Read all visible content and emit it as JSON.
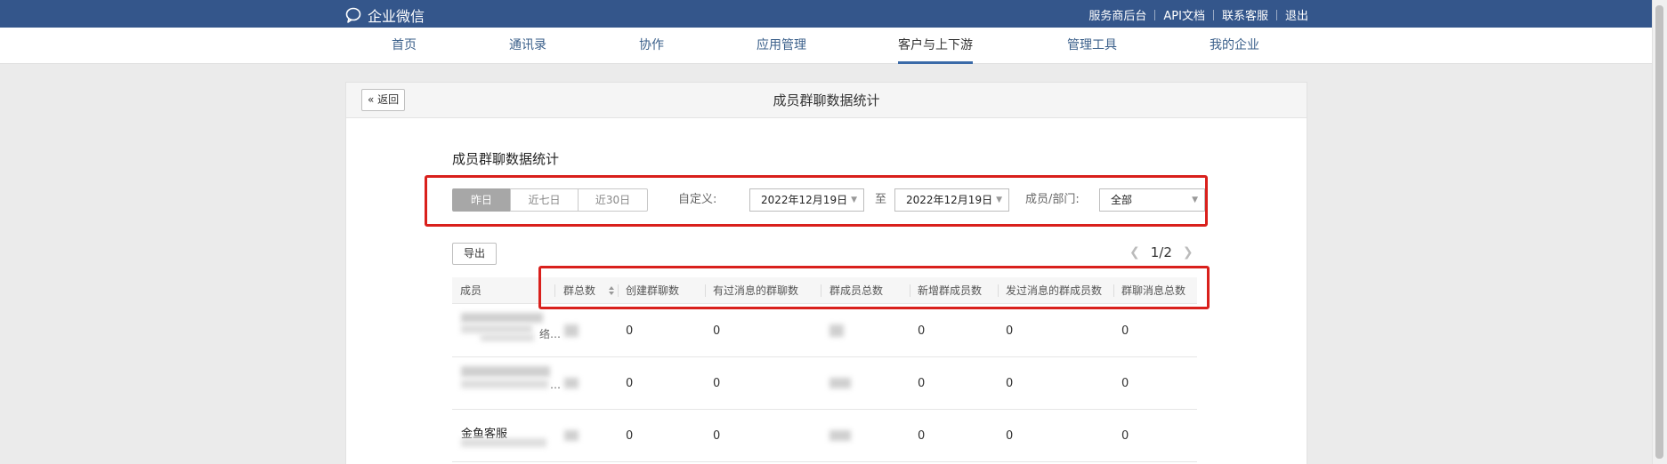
{
  "app": {
    "name": "企业微信",
    "top_links": [
      "服务商后台",
      "API文档",
      "联系客服",
      "退出"
    ]
  },
  "nav": {
    "items": [
      "首页",
      "通讯录",
      "协作",
      "应用管理",
      "客户与上下游",
      "管理工具",
      "我的企业"
    ],
    "active": "客户与上下游"
  },
  "panel": {
    "back_label": "返回",
    "title": "成员群聊数据统计"
  },
  "section": {
    "title": "成员群聊数据统计"
  },
  "filters": {
    "ranges": [
      "昨日",
      "近七日",
      "近30日"
    ],
    "active_range": "昨日",
    "custom_label": "自定义:",
    "start_date": "2022年12月19日",
    "to_label": "至",
    "end_date": "2022年12月19日",
    "member_label": "成员/部门:",
    "member_value": "全部"
  },
  "toolbar": {
    "export_label": "导出"
  },
  "pager": {
    "text": "1/2"
  },
  "table": {
    "columns": [
      "成员",
      "群总数",
      "创建群聊数",
      "有过消息的群聊数",
      "群成员总数",
      "新增群成员数",
      "发过消息的群成员数",
      "群聊消息总数"
    ],
    "rows": [
      {
        "member_suffix": "络…",
        "created": "0",
        "with_msg": "0",
        "new_members": "0",
        "msg_members": "0",
        "messages": "0"
      },
      {
        "member_suffix": "…",
        "created": "0",
        "with_msg": "0",
        "new_members": "0",
        "msg_members": "0",
        "messages": "0"
      },
      {
        "member_name": "金鱼客服",
        "created": "0",
        "with_msg": "0",
        "new_members": "0",
        "msg_members": "0",
        "messages": "0"
      }
    ]
  },
  "colors": {
    "topbar": "#34568b",
    "nav_link": "#3a5f8a",
    "highlight_box": "#d9201c",
    "active_segment": "#a7a7a7"
  }
}
